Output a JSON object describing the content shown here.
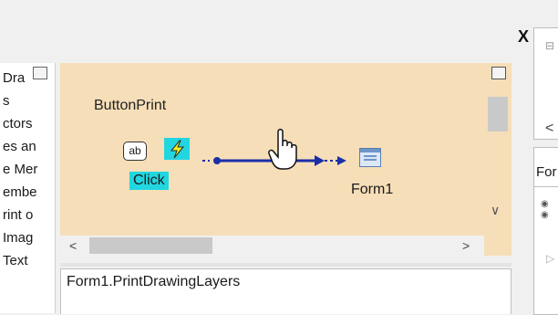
{
  "window": {
    "close_label": "X"
  },
  "left_panel": {
    "items": [
      "Dra",
      "s",
      "ctors",
      "es an",
      "e Mer",
      "embe",
      "rint o",
      "Imag",
      "Text"
    ]
  },
  "diagram": {
    "source_control_label": "ButtonPrint",
    "source_icon_text": "ab",
    "event_label": "Click",
    "target_label": "Form1"
  },
  "right_panel": {
    "bottom_label": "For"
  },
  "bottom_pane": {
    "text": "Form1.PrintDrawingLayers"
  },
  "colors": {
    "canvas_bg": "#f6deb8",
    "event_highlight": "#22d6e0",
    "connector": "#1a2fa8",
    "bolt_bg": "#22d6e0"
  },
  "icons": [
    "close-icon",
    "pin-icon",
    "textbox-icon",
    "event-bolt-icon",
    "form-icon",
    "hand-cursor-icon",
    "chevron-left-icon",
    "chevron-right-icon",
    "chevron-down-icon"
  ]
}
